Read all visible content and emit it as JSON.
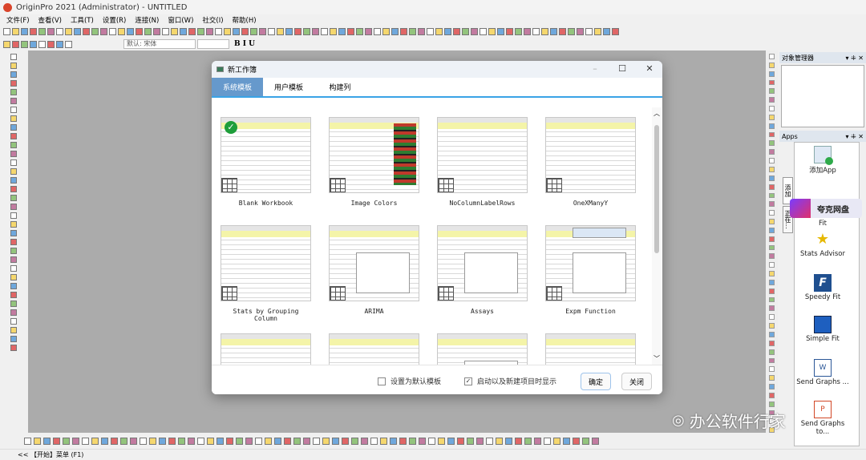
{
  "app": {
    "title": "OriginPro 2021 (Administrator) - UNTITLED"
  },
  "menu": [
    "文件(F)",
    "查看(V)",
    "工具(T)",
    "设置(R)",
    "连接(N)",
    "窗口(W)",
    "社交(I)",
    "帮助(H)"
  ],
  "toolbar": {
    "font_combo": "默认: 宋体",
    "text_style_label": "B I U"
  },
  "object_manager": {
    "title": "对象管理器"
  },
  "apps_panel": {
    "title": "Apps",
    "tabs": [
      "添加",
      "正在..."
    ],
    "items": [
      {
        "label": "添加App",
        "icon": "add-app-icon"
      },
      {
        "label": "Fit",
        "icon": "peak-fit-icon"
      },
      {
        "label": "Stats Advisor",
        "icon": "magic-wand-icon"
      },
      {
        "label": "Speedy Fit",
        "icon": "speedy-fit-icon"
      },
      {
        "label": "Simple Fit",
        "icon": "simple-fit-icon"
      },
      {
        "label": "Send Graphs ...",
        "icon": "word-icon"
      },
      {
        "label": "Send Graphs to...",
        "icon": "powerpoint-icon"
      }
    ]
  },
  "overlay": {
    "quark_label": "夸克网盘",
    "watermark": "办公软件行家"
  },
  "status": {
    "text": "<< 【开始】菜单 (F1)"
  },
  "dialog": {
    "title": "新工作簿",
    "tabs": [
      {
        "label": "系统模板",
        "active": true
      },
      {
        "label": "用户模板",
        "active": false
      },
      {
        "label": "构建列",
        "active": false
      }
    ],
    "templates": [
      {
        "label": "Blank Workbook",
        "selected": true
      },
      {
        "label": "Image Colors"
      },
      {
        "label": "NoColumnLabelRows"
      },
      {
        "label": "OneXManyY"
      },
      {
        "label": "Stats by Grouping Column"
      },
      {
        "label": "ARIMA"
      },
      {
        "label": "Assays"
      },
      {
        "label": "Expm Function"
      },
      {
        "label": ""
      },
      {
        "label": ""
      },
      {
        "label": ""
      },
      {
        "label": ""
      }
    ],
    "footer": {
      "default_template_label": "设置为默认模板",
      "default_template_checked": false,
      "show_on_startup_label": "启动以及新建项目时显示",
      "show_on_startup_checked": true,
      "ok_label": "确定",
      "close_label": "关闭",
      "checkmark": "✓"
    },
    "accent_color": "#6699cc"
  }
}
